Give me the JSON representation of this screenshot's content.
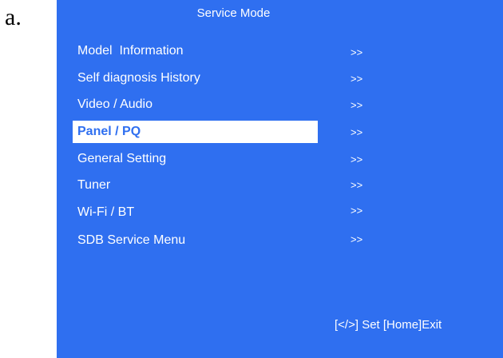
{
  "figure_label": "a.",
  "screen": {
    "title": "Service Mode",
    "selected_index": 3,
    "menu": [
      {
        "label": "Model  Information",
        "arrow": ">>"
      },
      {
        "label": "Self diagnosis History",
        "arrow": ">>"
      },
      {
        "label": "Video / Audio",
        "arrow": ">>"
      },
      {
        "label": "Panel / PQ",
        "arrow": ">>"
      },
      {
        "label": "General Setting",
        "arrow": ">>"
      },
      {
        "label": "Tuner",
        "arrow": ">>"
      },
      {
        "label": "Wi-Fi / BT",
        "arrow": ">>"
      },
      {
        "label": "SDB Service Menu",
        "arrow": ">>"
      }
    ],
    "help_text": "[</>] Set [Home]Exit"
  },
  "colors": {
    "background": "#2f6ff0",
    "text": "#ffffff",
    "highlight": "#ffffff",
    "highlight_text": "#2f6ff0"
  }
}
